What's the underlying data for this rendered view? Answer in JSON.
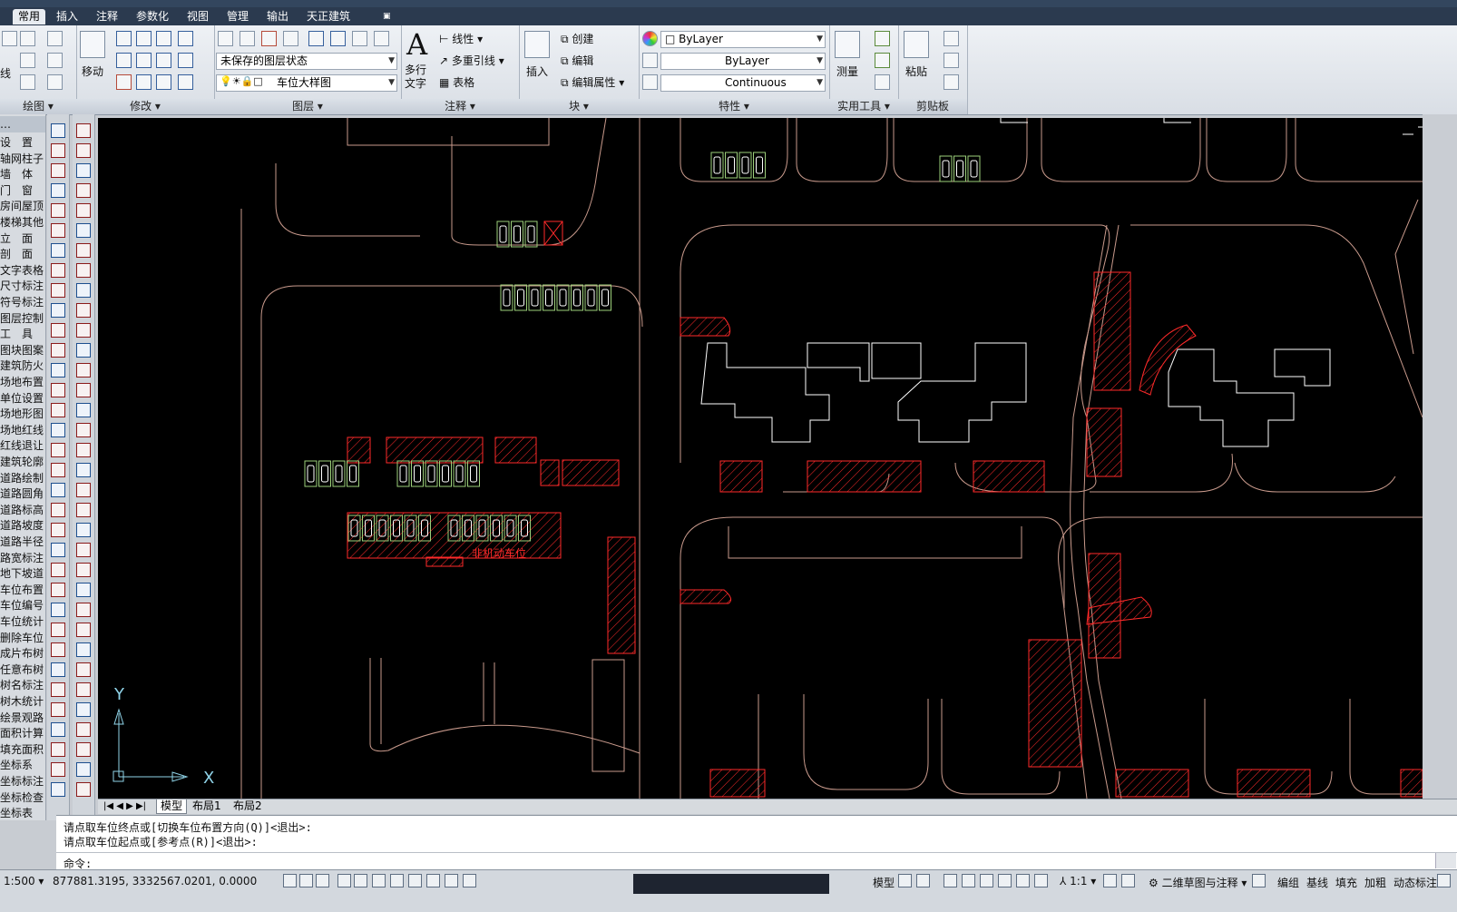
{
  "tabs": [
    "常用",
    "插入",
    "注释",
    "参数化",
    "视图",
    "管理",
    "输出",
    "天正建筑"
  ],
  "panels": {
    "draw": {
      "label": "绘图",
      "partial": "线"
    },
    "modify": {
      "label": "修改",
      "move": "移动"
    },
    "layers": {
      "label": "图层",
      "state": "未保存的图层状态",
      "current": "车位大样图"
    },
    "annotation": {
      "label": "注释",
      "mtext": "多行\n文字",
      "linear": "线性",
      "mleader": "多重引线",
      "table": "表格"
    },
    "block": {
      "label": "块",
      "insert": "插入",
      "create": "创建",
      "edit": "编辑",
      "edit_attr": "编辑属性"
    },
    "properties": {
      "label": "特性",
      "color": "ByLayer",
      "lineweight": "ByLayer",
      "linetype": "Continuous"
    },
    "utilities": {
      "label": "实用工具",
      "measure": "测量"
    },
    "clipboard": {
      "label": "剪贴板",
      "paste": "粘贴"
    }
  },
  "left_menu": [
    "设　置",
    "轴网柱子",
    "墙　体",
    "门　窗",
    "房间屋顶",
    "楼梯其他",
    "立　面",
    "剖　面",
    "文字表格",
    "尺寸标注",
    "符号标注",
    "图层控制",
    "工　具",
    "图块图案",
    "建筑防火",
    "场地布置",
    "单位设置",
    "场地形图",
    "场地红线",
    "红线退让",
    "建筑轮廓",
    "道路绘制",
    "道路圆角",
    "道路标高",
    "道路坡度",
    "道路半径",
    "路宽标注",
    "地下坡道",
    "车位布置",
    "车位编号",
    "车位统计",
    "删除车位",
    "成片布树",
    "任意布树",
    "树名标注",
    "树木统计",
    "绘景观路",
    "面积计算",
    "填充面积",
    "坐标系",
    "坐标标注",
    "坐标检查",
    "坐标表"
  ],
  "canvas": {
    "annotation": "非机动车位",
    "ucs_x": "X",
    "ucs_y": "Y"
  },
  "layout_tabs": [
    "模型",
    "布局1",
    "布局2"
  ],
  "command": {
    "line1": "请点取车位终点或[切换车位布置方向(Q)]<退出>:",
    "line2": "请点取车位起点或[参考点(R)]<退出>:",
    "prompt": "命令:"
  },
  "status": {
    "scale": "1:500",
    "coords": "877881.3195, 3332567.0201, 0.0000",
    "model": "模型",
    "anno_scale": "1:1",
    "workspace": "二维草图与注释",
    "tianzheng": [
      "编组",
      "基线",
      "填充",
      "加粗",
      "动态标注"
    ]
  },
  "colors": {
    "canvas": "#000000",
    "red": "#ff2a2a",
    "green": "#9ccf7a",
    "white": "#ffffff",
    "boundary": "#c99a8c"
  }
}
